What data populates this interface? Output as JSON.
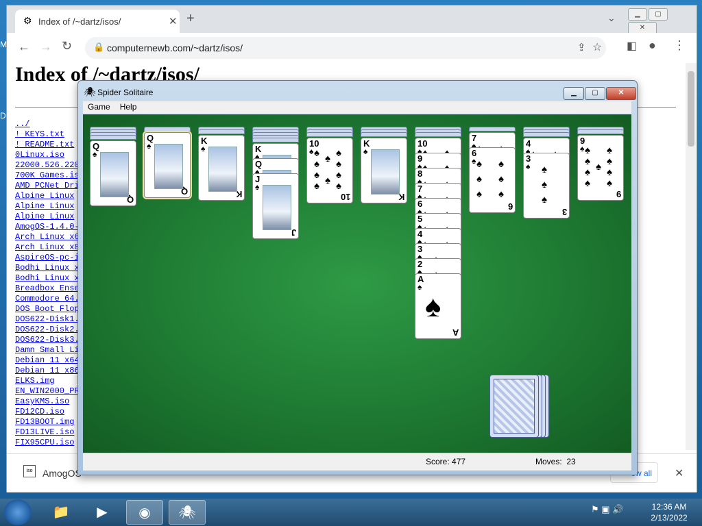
{
  "desktop": {
    "left_letters": [
      "M",
      "D"
    ]
  },
  "browser": {
    "tab": {
      "title": "Index of /~dartz/isos/"
    },
    "url": "computernewb.com/~dartz/isos/",
    "page_heading": "Index of /~dartz/isos/",
    "links": [
      "../",
      "! KEYS.txt",
      "! README.txt",
      "0Linux.iso",
      "22000.526.220",
      "700K Games.is",
      "AMD PCNet Dri",
      "Alpine Linux ",
      "Alpine Linux ",
      "Alpine Linux ",
      "AmogOS-1.4.0-",
      "Arch Linux x6",
      "Arch Linux x8",
      "AspireOS-pc-i",
      "Bodhi Linux x",
      "Bodhi Linux x",
      "Breadbox Ense",
      "Commodore 64.",
      "DOS Boot Flop",
      "DOS622-Disk1.",
      "DOS622-Disk2.",
      "DOS622-Disk3.",
      "Damn Small Li",
      "Debian 11 x64",
      "Debian 11 x86",
      "ELKS.img",
      "EN_WIN2000_PR",
      "EasyKMS.iso",
      "FD12CD.iso",
      "FD13BOOT.img",
      "FD13LIVE.iso",
      "FIX95CPU.iso"
    ],
    "download": {
      "name": "AmogOS",
      "icon_text": "iso",
      "show_all": "ow all"
    }
  },
  "spider": {
    "title": "Spider Solitaire",
    "menu": [
      "Game",
      "Help"
    ],
    "score_label": "Score: 477",
    "moves_label": "Moves:",
    "moves_value": "23",
    "suit": "♠",
    "columns": [
      {
        "hidden": 4,
        "face": [
          {
            "rank": "Q",
            "face_card": true
          }
        ]
      },
      {
        "hidden": 1,
        "face": [
          {
            "rank": "Q",
            "face_card": true,
            "selected": true
          }
        ]
      },
      {
        "hidden": 2,
        "face": [
          {
            "rank": "K",
            "face_card": true
          }
        ]
      },
      {
        "hidden": 5,
        "face": [
          {
            "rank": "K",
            "face_card": true
          },
          {
            "rank": "Q",
            "face_card": true
          },
          {
            "rank": "J",
            "face_card": true
          }
        ]
      },
      {
        "hidden": 3,
        "face": [
          {
            "rank": "10"
          }
        ]
      },
      {
        "hidden": 3,
        "face": [
          {
            "rank": "K",
            "face_card": true
          }
        ]
      },
      {
        "hidden": 3,
        "face": [
          {
            "rank": "10"
          },
          {
            "rank": "9"
          },
          {
            "rank": "8"
          },
          {
            "rank": "7"
          },
          {
            "rank": "6"
          },
          {
            "rank": "5"
          },
          {
            "rank": "4"
          },
          {
            "rank": "3"
          },
          {
            "rank": "2"
          },
          {
            "rank": "A"
          }
        ]
      },
      {
        "hidden": 1,
        "face": [
          {
            "rank": "7"
          },
          {
            "rank": "6"
          }
        ]
      },
      {
        "hidden": 3,
        "face": [
          {
            "rank": "4"
          },
          {
            "rank": "3"
          }
        ]
      },
      {
        "hidden": 2,
        "face": [
          {
            "rank": "9"
          }
        ]
      }
    ],
    "stock_piles": 4
  },
  "taskbar": {
    "apps": [
      "folder-icon",
      "media-player-icon",
      "chrome-icon",
      "spider-solitaire-icon"
    ],
    "time": "12:36 AM",
    "date": "2/13/2022"
  },
  "colors": {
    "felt": "#1e7a32",
    "taskbar": "#2b5c86",
    "link": "#0000ee"
  }
}
